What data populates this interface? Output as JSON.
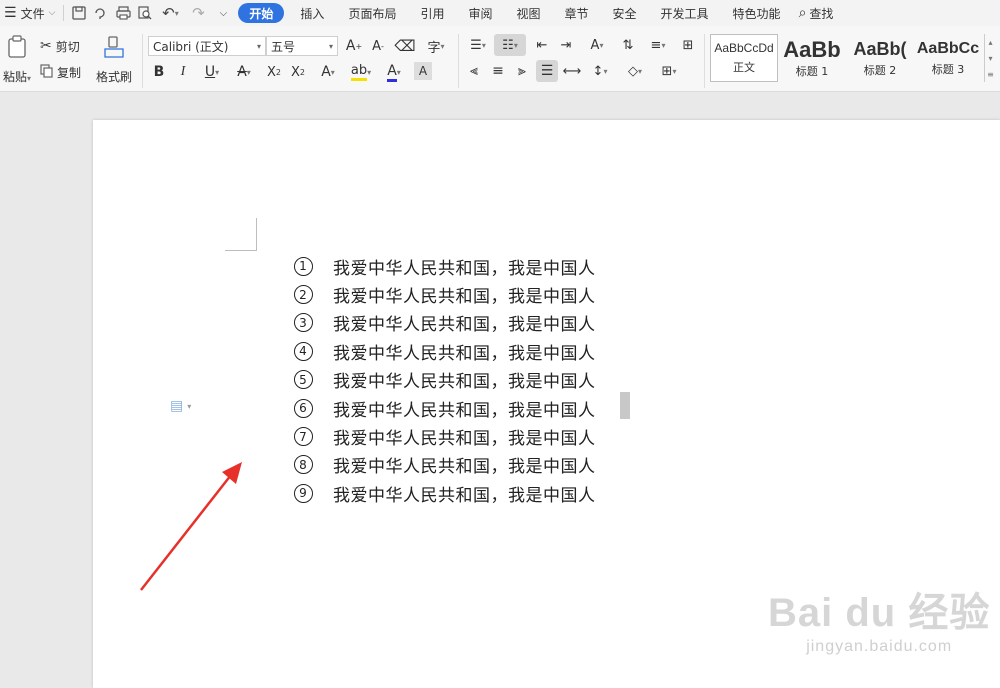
{
  "menubar": {
    "file_label": "文件",
    "tabs": [
      "开始",
      "插入",
      "页面布局",
      "引用",
      "审阅",
      "视图",
      "章节",
      "安全",
      "开发工具",
      "特色功能"
    ],
    "search_label": "查找"
  },
  "ribbon": {
    "paste_label": "粘贴",
    "cut_label": "剪切",
    "copy_label": "复制",
    "format_painter_label": "格式刷",
    "font_name": "Calibri (正文)",
    "font_size": "五号",
    "styles": [
      {
        "preview": "AaBbCcDd",
        "name": "正文"
      },
      {
        "preview": "AaBb",
        "name": "标题 1"
      },
      {
        "preview": "AaBb(",
        "name": "标题 2"
      },
      {
        "preview": "AaBbCc",
        "name": "标题 3"
      }
    ]
  },
  "document": {
    "list": [
      {
        "num": "1",
        "text": "我爱中华人民共和国，我是中国人"
      },
      {
        "num": "2",
        "text": "我爱中华人民共和国，我是中国人"
      },
      {
        "num": "3",
        "text": "我爱中华人民共和国，我是中国人"
      },
      {
        "num": "4",
        "text": "我爱中华人民共和国，我是中国人"
      },
      {
        "num": "5",
        "text": "我爱中华人民共和国，我是中国人"
      },
      {
        "num": "6",
        "text": "我爱中华人民共和国，我是中国人"
      },
      {
        "num": "7",
        "text": "我爱中华人民共和国，我是中国人"
      },
      {
        "num": "8",
        "text": "我爱中华人民共和国，我是中国人"
      },
      {
        "num": "9",
        "text": "我爱中华人民共和国，我是中国人"
      }
    ]
  },
  "watermark": {
    "main": "Bai du 经验",
    "sub": "jingyan.baidu.com"
  },
  "colors": {
    "accent": "#2f73e0",
    "arrow": "#e8302a"
  },
  "icons": [
    "menu-icon",
    "save-icon",
    "print-icon",
    "undo-icon",
    "redo-icon",
    "search-icon",
    "paste-icon",
    "scissors-icon",
    "copy-icon",
    "brush-icon"
  ]
}
